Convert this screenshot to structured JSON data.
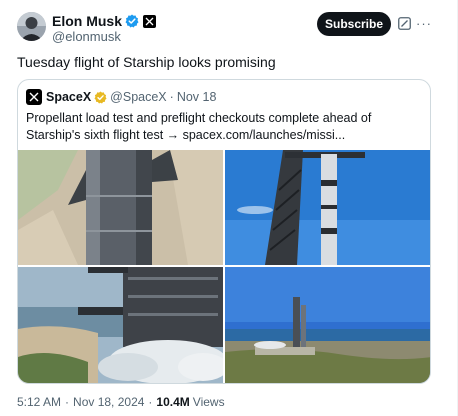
{
  "author": {
    "name": "Elon Musk",
    "handle": "@elonmusk",
    "avatar_icon": "avatar-image",
    "verified_color": "#1d9bf0"
  },
  "header": {
    "subscribe_label": "Subscribe",
    "grok_icon": "grok-icon",
    "more_icon": "more-icon",
    "more_glyph": "···"
  },
  "tweet": {
    "text": "Tuesday flight of Starship looks promising"
  },
  "quote": {
    "name": "SpaceX",
    "handle": "@SpaceX",
    "separator": "·",
    "date": "Nov 18",
    "badge_color": "#e8b923",
    "text": "Propellant load test and preflight checkouts complete ahead of Starship's sixth flight test → spacex.com/launches/missi...",
    "media": [
      {
        "alt": "starship-booster-closeup-photo"
      },
      {
        "alt": "starship-on-launch-tower-photo"
      },
      {
        "alt": "booster-venting-on-pad-photo"
      },
      {
        "alt": "launch-site-coastline-photo"
      }
    ]
  },
  "footer": {
    "time": "5:12 AM",
    "separator": "·",
    "date": "Nov 18, 2024",
    "views_count": "10.4M",
    "views_label": "Views"
  }
}
